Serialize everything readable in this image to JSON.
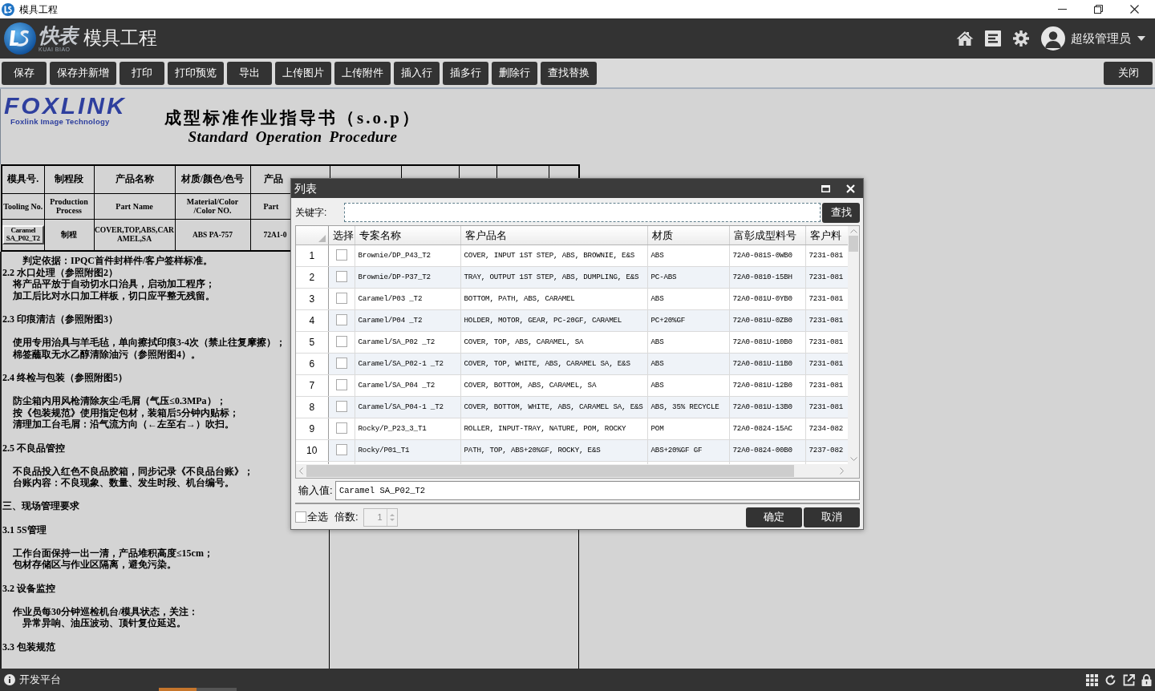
{
  "window": {
    "title": "模具工程"
  },
  "header": {
    "logo_text": "快表",
    "logo_subtext": "KUAI BIAO",
    "app_title": "模具工程",
    "user_name": "超级管理员"
  },
  "toolbar": {
    "buttons": [
      "保存",
      "保存并新增",
      "打印",
      "打印预览",
      "导出",
      "上传图片",
      "上传附件",
      "插入行",
      "插多行",
      "删除行",
      "查找替换"
    ],
    "close_button": "关闭"
  },
  "document": {
    "logo": "FOXLINK",
    "logo_caption": "Foxlink Image Technology",
    "title": "成型标准作业指导书（s.o.p）",
    "subtitle": "Standard Operation Procedure",
    "table": {
      "rows": [
        {
          "cells": [
            {
              "text": "模具号.",
              "selected": false
            },
            {
              "text": "制程段",
              "selected": false
            },
            {
              "text": "产品名称",
              "selected": false
            },
            {
              "text": "材质/颜色/色号",
              "selected": false
            },
            {
              "text": "产品",
              "selected": false
            }
          ]
        },
        {
          "cells": [
            {
              "text": "Tooling No.",
              "selected": false
            },
            {
              "text": "Production Process",
              "selected": false
            },
            {
              "text": "Part Name",
              "selected": false
            },
            {
              "text": "Material/Color /Color NO.",
              "selected": false
            },
            {
              "text": "Part",
              "selected": false
            }
          ]
        },
        {
          "cells": [
            {
              "text": "Caramel SA_P02_T2",
              "selected": true
            },
            {
              "text": "制程",
              "selected": false
            },
            {
              "text": "COVER,TOP,ABS,CARAMEL,SA",
              "selected": false
            },
            {
              "text": "ABS PA-757",
              "selected": false
            },
            {
              "text": "72A1-0",
              "selected": false
            }
          ]
        }
      ]
    },
    "lines": [
      {
        "kind": "detail",
        "text": "判定依据：IPQC首件封样件/客户签样标准。"
      },
      {
        "kind": "heading",
        "text": "2.2 水口处理（参照附图2）"
      },
      {
        "kind": "step",
        "text": "将产品平放于自动切水口治具，启动加工程序；"
      },
      {
        "kind": "step",
        "text": "加工后比对水口加工样板，切口应平整无残留。"
      },
      {
        "kind": "blank"
      },
      {
        "kind": "heading",
        "text": "2.3 印痕清洁（参照附图3）"
      },
      {
        "kind": "blank"
      },
      {
        "kind": "step",
        "text": "使用专用治具与羊毛毡，单向擦拭印痕3-4次（禁止往复摩擦）；"
      },
      {
        "kind": "step",
        "text": "棉签蘸取无水乙醇清除油污（参照附图4）。"
      },
      {
        "kind": "blank"
      },
      {
        "kind": "heading",
        "text": "2.4 终检与包装（参照附图5）"
      },
      {
        "kind": "blank"
      },
      {
        "kind": "step",
        "text": "防尘箱内用风枪清除灰尘/毛屑（气压≤0.3MPa）；"
      },
      {
        "kind": "step",
        "text": "按《包装规范》使用指定包材，装箱后5分钟内贴标；"
      },
      {
        "kind": "step",
        "text": "清理加工台毛屑：沿气流方向（←左至右→）吹扫。"
      },
      {
        "kind": "blank"
      },
      {
        "kind": "heading",
        "text": "2.5 不良品管控"
      },
      {
        "kind": "blank"
      },
      {
        "kind": "step",
        "text": "不良品投入红色不良品胶箱，同步记录《不良品台账》；"
      },
      {
        "kind": "step",
        "text": "台账内容：不良现象、数量、发生时段、机台编号。"
      },
      {
        "kind": "blank"
      },
      {
        "kind": "heading",
        "text": "三、现场管理要求"
      },
      {
        "kind": "blank"
      },
      {
        "kind": "heading",
        "text": "3.1 5S管理"
      },
      {
        "kind": "blank"
      },
      {
        "kind": "step",
        "text": "工作台面保持一出一清，产品堆积高度≤15cm；"
      },
      {
        "kind": "step",
        "text": "包材存储区与作业区隔离，避免污染。"
      },
      {
        "kind": "blank"
      },
      {
        "kind": "heading",
        "text": "3.2 设备监控"
      },
      {
        "kind": "blank"
      },
      {
        "kind": "step",
        "text": "作业员每30分钟巡检机台/模具状态，关注："
      },
      {
        "kind": "detail",
        "text": "异常异响、油压波动、顶针复位延迟。"
      },
      {
        "kind": "blank"
      },
      {
        "kind": "heading",
        "text": "3.3 包装规范"
      }
    ]
  },
  "dialog": {
    "title": "列表",
    "keyword_label": "关键字:",
    "search_button": "查找",
    "grid": {
      "select_header": "选择",
      "columns": [
        "专案名称",
        "客户品名",
        "材质",
        "富彰成型料号",
        "客户料"
      ],
      "rows": [
        {
          "number": "1",
          "checked": false,
          "cells": [
            "Brownie/DP_P43_T2",
            "COVER, INPUT 1ST STEP, ABS, BROWNIE, E&S",
            "ABS",
            "72A0-081S-0WB0",
            "7231-081"
          ]
        },
        {
          "number": "2",
          "checked": false,
          "cells": [
            "Brownie/DP-P37_T2",
            "TRAY, OUTPUT 1ST STEP, ABS, DUMPLING, E&S",
            "PC-ABS",
            "72A0-0810-15BH",
            "7231-081"
          ]
        },
        {
          "number": "3",
          "checked": false,
          "cells": [
            "Caramel/P03 _T2",
            "BOTTOM, PATH, ABS, CARAMEL",
            "ABS",
            "72A0-081U-0YB0",
            "7231-081"
          ]
        },
        {
          "number": "4",
          "checked": false,
          "cells": [
            "Caramel/P04 _T2",
            "HOLDER, MOTOR, GEAR, PC-20GF, CARAMEL",
            "PC+20%GF",
            "72A0-081U-0ZB0",
            "7231-081"
          ]
        },
        {
          "number": "5",
          "checked": false,
          "cells": [
            "Caramel/SA_P02 _T2",
            "COVER, TOP, ABS, CARAMEL, SA",
            "ABS",
            "72A0-081U-10B0",
            "7231-081"
          ]
        },
        {
          "number": "6",
          "checked": false,
          "cells": [
            "Caramel/SA_P02-1 _T2",
            "COVER, TOP, WHITE, ABS, CARAMEL SA, E&S",
            "ABS",
            "72A0-081U-11B0",
            "7231-081"
          ]
        },
        {
          "number": "7",
          "checked": false,
          "cells": [
            "Caramel/SA_P04 _T2",
            "COVER, BOTTOM, ABS, CARAMEL, SA",
            "ABS",
            "72A0-081U-12B0",
            "7231-081"
          ]
        },
        {
          "number": "8",
          "checked": false,
          "cells": [
            "Caramel/SA_P04-1 _T2",
            "COVER, BOTTOM, WHITE, ABS, CARAMEL SA, E&S",
            "ABS, 35% RECYCLE",
            "72A0-081U-13B0",
            "7231-081"
          ]
        },
        {
          "number": "9",
          "checked": false,
          "cells": [
            "Rocky/P_P23_3_T1",
            "ROLLER, INPUT-TRAY, NATURE, POM, ROCKY",
            "POM",
            "72A0-0824-15AC",
            "7234-082"
          ]
        },
        {
          "number": "10",
          "checked": false,
          "cells": [
            "Rocky/P01_T1",
            "PATH, TOP, ABS+20%GF, ROCKY, E&S",
            "ABS+20%GF GF",
            "72A0-0824-00B0",
            "7237-082"
          ]
        }
      ]
    },
    "value_label": "输入值:",
    "value": "Caramel SA_P02_T2",
    "select_all": {
      "label": "全选",
      "checked": false
    },
    "multiplier": {
      "label": "倍数:",
      "value": "1",
      "disabled": true
    },
    "buttons": [
      "确定",
      "取消"
    ]
  },
  "status_bar": {
    "text": "开发平台"
  }
}
